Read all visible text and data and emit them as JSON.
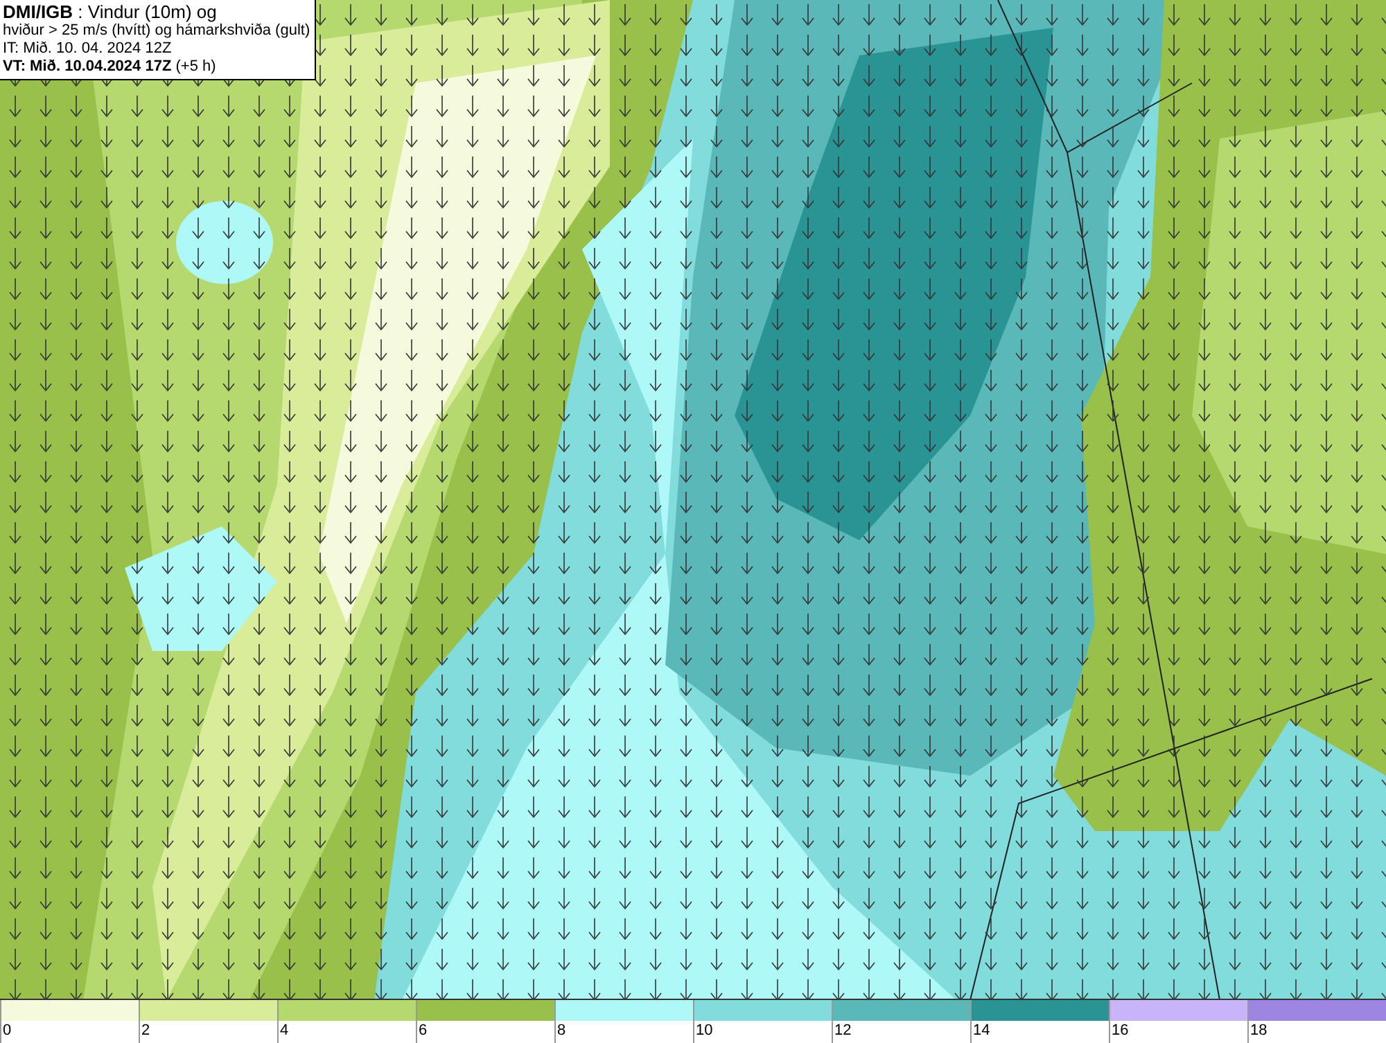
{
  "info_box": {
    "lines": [
      {
        "text": "**DMI/IGB** : Vindur (10m) og"
      },
      {
        "text": "hviður > 25 m/s (hvítt) og hámarkshviða (gult)"
      },
      {
        "text": "IT: Mið. 10. 04. 2024 12Z"
      },
      {
        "text": "**VT: Mið. 10.04.2024 17Z** (+5 h)"
      }
    ]
  },
  "legend": {
    "bins": [
      {
        "label": "0",
        "color": "#f5fadc"
      },
      {
        "label": "2",
        "color": "#d8ec9a"
      },
      {
        "label": "4",
        "color": "#b5d96e"
      },
      {
        "label": "6",
        "color": "#98c04a"
      },
      {
        "label": "8",
        "color": "#aef8f8"
      },
      {
        "label": "10",
        "color": "#82dcdc"
      },
      {
        "label": "12",
        "color": "#5ab8b8"
      },
      {
        "label": "14",
        "color": "#2a9494"
      },
      {
        "label": "16",
        "color": "#c8b4f8"
      },
      {
        "label": "18",
        "color": "#9c84e0"
      }
    ]
  }
}
